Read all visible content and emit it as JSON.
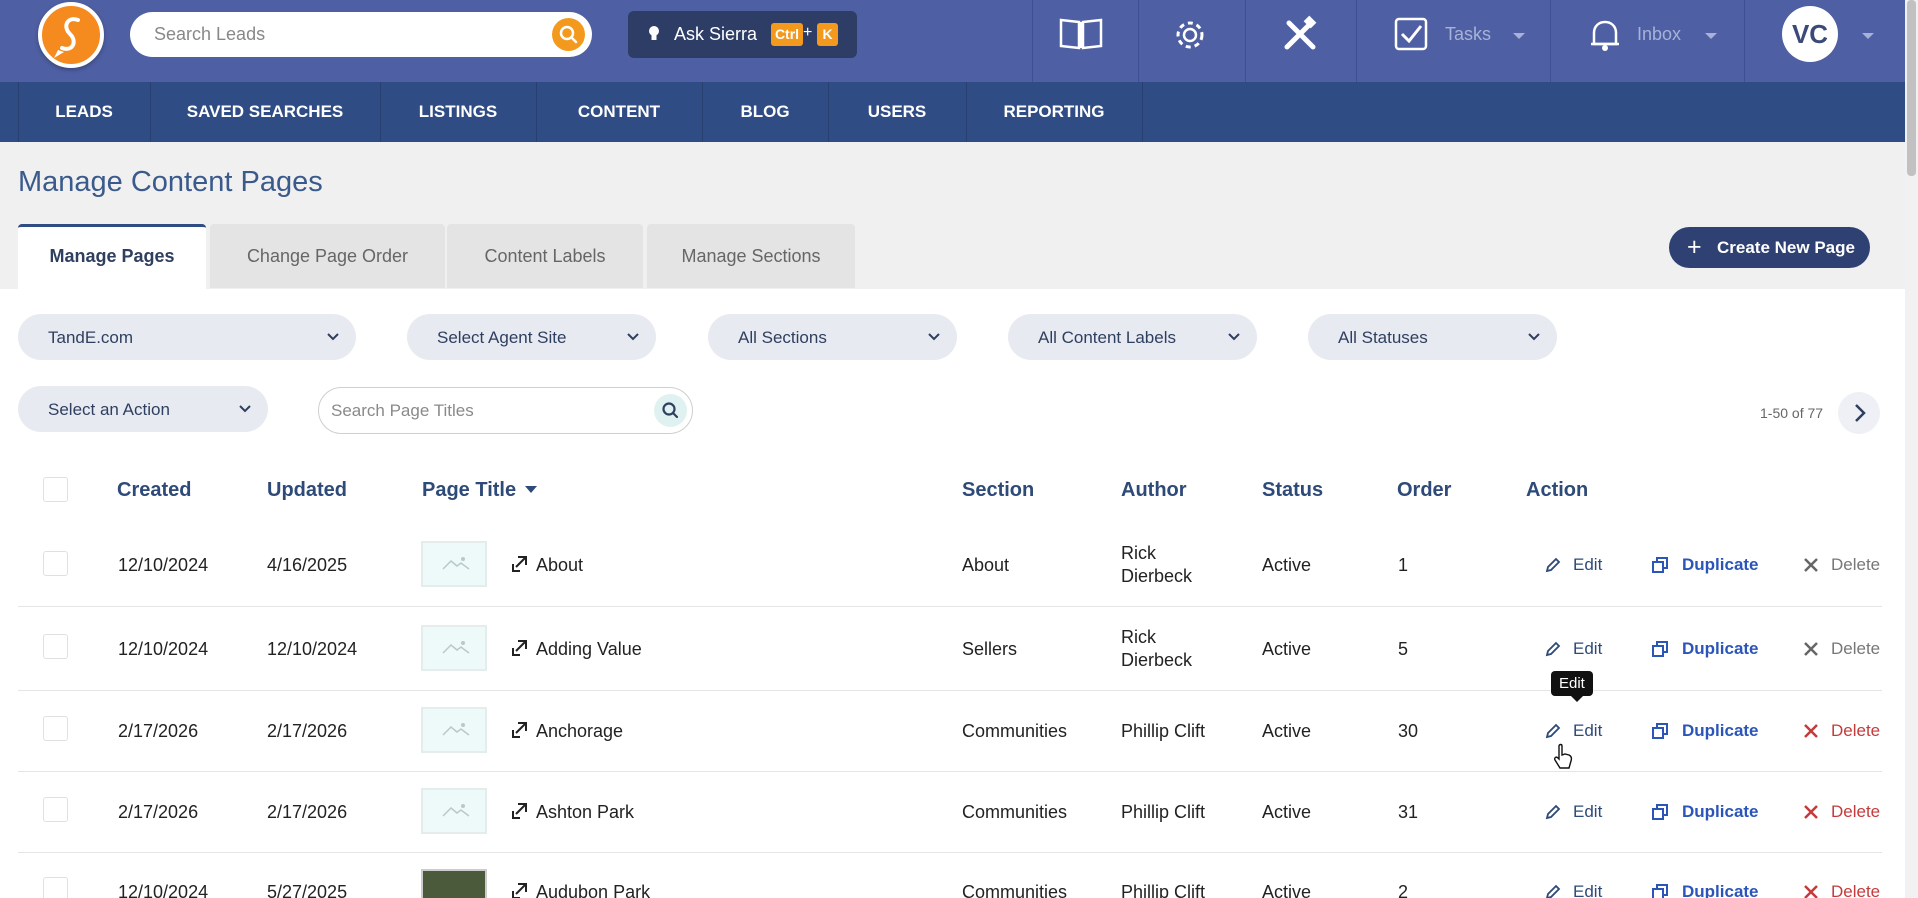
{
  "topbar": {
    "search_placeholder": "Search Leads",
    "ask": {
      "label": "Ask Sierra",
      "key1": "Ctrl",
      "plus": "+",
      "key2": "K"
    },
    "tasks_label": "Tasks",
    "inbox_label": "Inbox",
    "avatar_initials": "VC",
    "icons": [
      "book-icon",
      "gear-icon",
      "tools-icon",
      "checkbox-icon",
      "bell-icon"
    ]
  },
  "nav": {
    "items": [
      "LEADS",
      "SAVED SEARCHES",
      "LISTINGS",
      "CONTENT",
      "BLOG",
      "USERS",
      "REPORTING"
    ]
  },
  "page": {
    "title": "Manage Content Pages",
    "tabs": [
      "Manage Pages",
      "Change Page Order",
      "Content Labels",
      "Manage Sections"
    ],
    "active_tab": "Manage Pages",
    "create_button": "Create New Page",
    "create_plus": "+"
  },
  "filters": {
    "site": "TandE.com",
    "agent_site": "Select Agent Site",
    "sections": "All Sections",
    "content_labels": "All Content Labels",
    "statuses": "All Statuses",
    "action": "Select an Action",
    "search_placeholder": "Search Page Titles",
    "pager_text": "1-50 of 77"
  },
  "table": {
    "headers": {
      "created": "Created",
      "updated": "Updated",
      "page_title": "Page Title",
      "section": "Section",
      "author": "Author",
      "status": "Status",
      "order": "Order",
      "action": "Action"
    },
    "actions": {
      "edit": "Edit",
      "duplicate": "Duplicate",
      "delete": "Delete"
    },
    "rows": [
      {
        "created": "12/10/2024",
        "updated": "4/16/2025",
        "title": "About",
        "section": "About",
        "author": "Rick Dierbeck",
        "status": "Active",
        "order": "1"
      },
      {
        "created": "12/10/2024",
        "updated": "12/10/2024",
        "title": "Adding Value",
        "section": "Sellers",
        "author": "Rick Dierbeck",
        "status": "Active",
        "order": "5"
      },
      {
        "created": "2/17/2026",
        "updated": "2/17/2026",
        "title": "Anchorage",
        "section": "Communities",
        "author": "Phillip Clift",
        "status": "Active",
        "order": "30"
      },
      {
        "created": "2/17/2026",
        "updated": "2/17/2026",
        "title": "Ashton Park",
        "section": "Communities",
        "author": "Phillip Clift",
        "status": "Active",
        "order": "31"
      },
      {
        "created": "12/10/2024",
        "updated": "5/27/2025",
        "title": "Audubon Park",
        "section": "Communities",
        "author": "Phillip Clift",
        "status": "Active",
        "order": "2"
      }
    ]
  },
  "tooltip": "Edit",
  "colors": {
    "topbar": "#4e5fa3",
    "navbar": "#2f4c84",
    "accent": "#f39a1e",
    "link": "#2b55b8",
    "delete": "#c53b3b"
  }
}
